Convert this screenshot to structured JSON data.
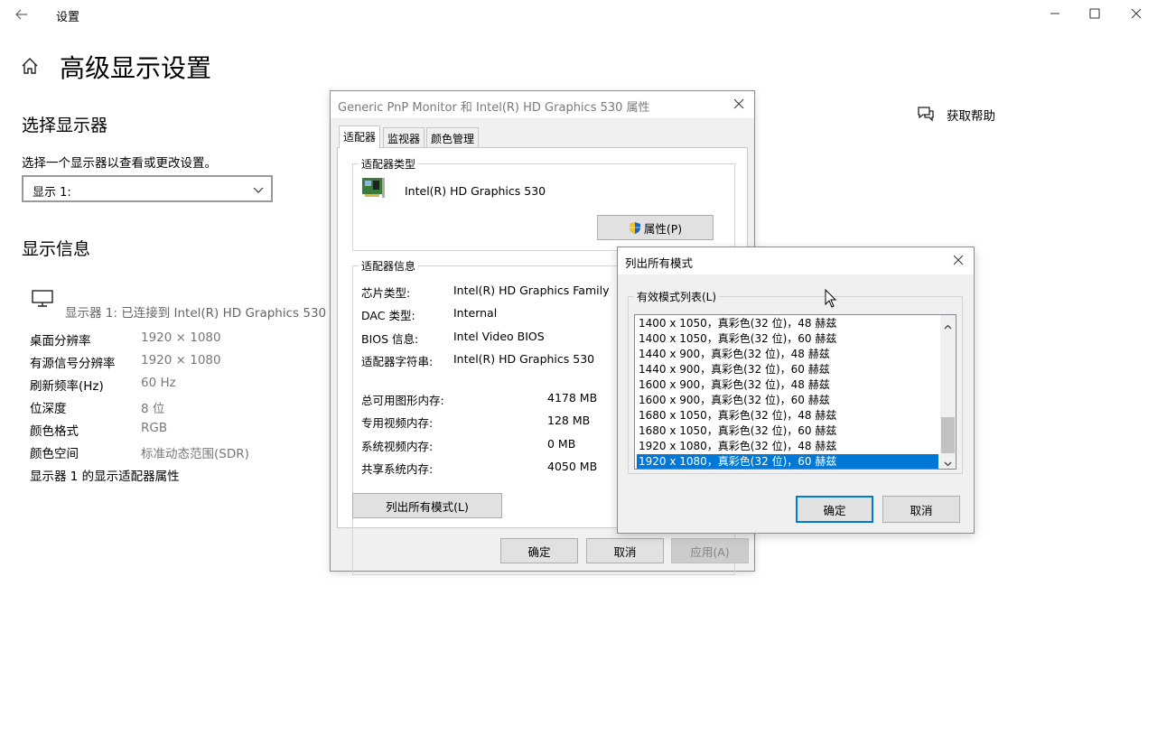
{
  "window": {
    "title": "设置",
    "back_icon": "back-arrow-icon",
    "minimize_icon": "minimize-icon",
    "maximize_icon": "maximize-icon",
    "close_icon": "close-icon"
  },
  "page": {
    "title": "高级显示设置",
    "select_display_heading": "选择显示器",
    "select_display_hint": "选择一个显示器以查看或更改设置。",
    "display_dropdown_value": "显示 1:",
    "display_info_heading": "显示信息",
    "monitor_connected": "显示器 1: 已连接到 Intel(R) HD Graphics 530",
    "info": [
      {
        "label": "桌面分辨率",
        "value": "1920 × 1080"
      },
      {
        "label": "有源信号分辨率",
        "value": "1920 × 1080"
      },
      {
        "label": "刷新频率(Hz)",
        "value": "60 Hz"
      },
      {
        "label": "位深度",
        "value": "8 位"
      },
      {
        "label": "颜色格式",
        "value": "RGB"
      },
      {
        "label": "颜色空间",
        "value": "标准动态范围(SDR)"
      }
    ],
    "adapter_properties_link": "显示器 1 的显示适配器属性",
    "help_text": "获取帮助"
  },
  "properties_dialog": {
    "title": "Generic PnP Monitor 和 Intel(R) HD Graphics 530 属性",
    "tabs": [
      "适配器",
      "监视器",
      "颜色管理"
    ],
    "adapter_type_group": "适配器类型",
    "adapter_name": "Intel(R) HD Graphics 530",
    "properties_button": "属性(P)",
    "adapter_info_group": "适配器信息",
    "adapter_info": [
      {
        "label": "芯片类型:",
        "value": "Intel(R) HD Graphics Family"
      },
      {
        "label": "DAC 类型:",
        "value": "Internal"
      },
      {
        "label": "BIOS 信息:",
        "value": "Intel Video BIOS"
      },
      {
        "label": "适配器字符串:",
        "value": "Intel(R) HD Graphics 530"
      }
    ],
    "memory": [
      {
        "label": "总可用图形内存:",
        "value": "4178 MB"
      },
      {
        "label": "专用视频内存:",
        "value": "128 MB"
      },
      {
        "label": "系统视频内存:",
        "value": "0 MB"
      },
      {
        "label": "共享系统内存:",
        "value": "4050 MB"
      }
    ],
    "list_modes_button": "列出所有模式(L)",
    "ok": "确定",
    "cancel": "取消",
    "apply": "应用(A)"
  },
  "modes_dialog": {
    "title": "列出所有模式",
    "group_label": "有效模式列表(L)",
    "modes": [
      "1400 x 1050，真彩色(32 位)，48 赫兹",
      "1400 x 1050，真彩色(32 位)，60 赫兹",
      "1440 x 900，真彩色(32 位)，48 赫兹",
      "1440 x 900，真彩色(32 位)，60 赫兹",
      "1600 x 900，真彩色(32 位)，48 赫兹",
      "1600 x 900，真彩色(32 位)，60 赫兹",
      "1680 x 1050，真彩色(32 位)，48 赫兹",
      "1680 x 1050，真彩色(32 位)，60 赫兹",
      "1920 x 1080，真彩色(32 位)，48 赫兹",
      "1920 x 1080，真彩色(32 位)，60 赫兹"
    ],
    "selected_index": 9,
    "ok": "确定",
    "cancel": "取消"
  },
  "colors": {
    "accent": "#0078d7",
    "dialog_bg": "#f0f0f0"
  }
}
